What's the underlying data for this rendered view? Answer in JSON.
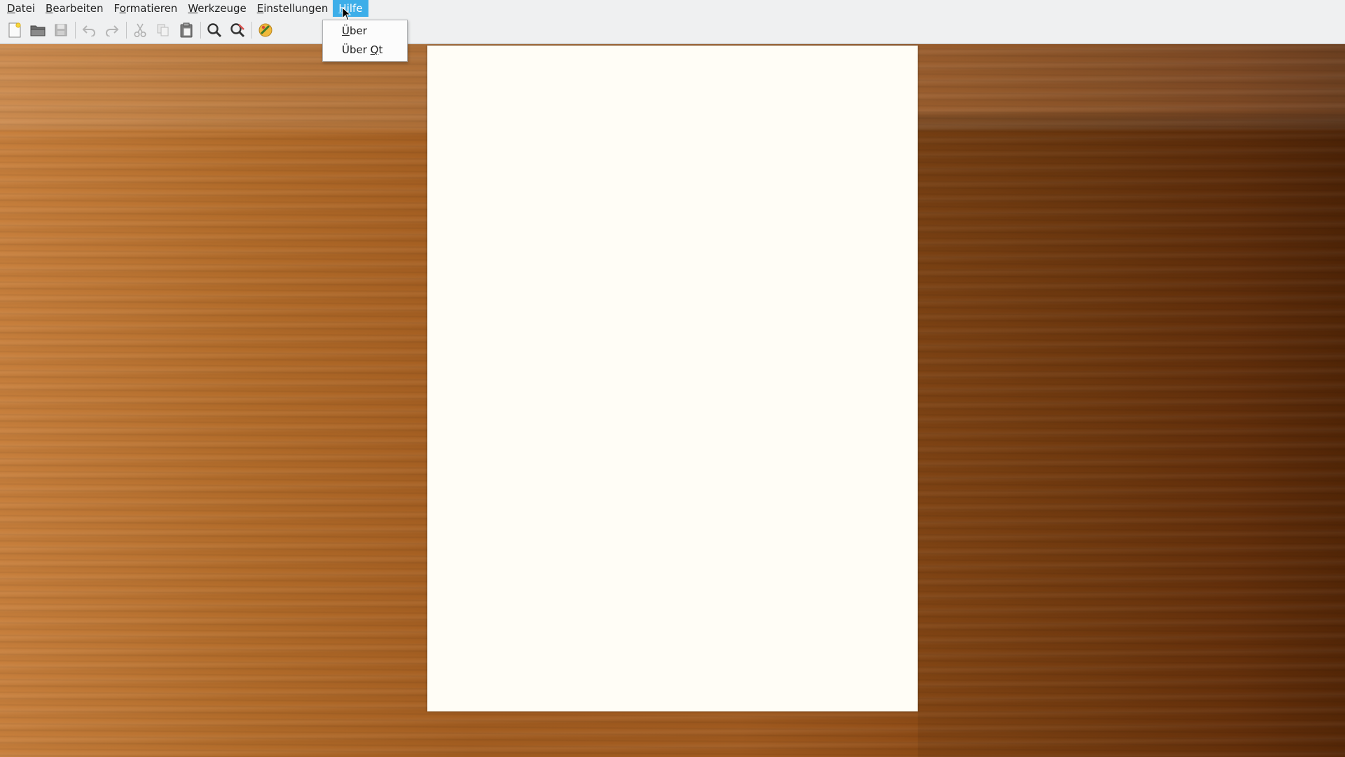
{
  "menubar": {
    "items": [
      {
        "pre": "",
        "ul": "D",
        "post": "atei"
      },
      {
        "pre": "",
        "ul": "B",
        "post": "earbeiten"
      },
      {
        "pre": "F",
        "ul": "o",
        "post": "rmatieren"
      },
      {
        "pre": "",
        "ul": "W",
        "post": "erkzeuge"
      },
      {
        "pre": "",
        "ul": "E",
        "post": "instellungen"
      },
      {
        "pre": "",
        "ul": "H",
        "post": "ilfe"
      }
    ]
  },
  "help_menu": {
    "items": [
      {
        "pre": "",
        "ul": "Ü",
        "post": "ber"
      },
      {
        "pre": "Über ",
        "ul": "Q",
        "post": "t"
      }
    ]
  },
  "toolbar": {
    "icons": [
      "new-document-icon",
      "open-folder-icon",
      "save-icon",
      "undo-icon",
      "redo-icon",
      "cut-icon",
      "copy-icon",
      "paste-icon",
      "find-icon",
      "find-replace-icon",
      "theme-icon"
    ]
  },
  "colors": {
    "menu_active": "#3daee9",
    "chrome": "#eff0f1",
    "paper": "#fffdf6"
  }
}
